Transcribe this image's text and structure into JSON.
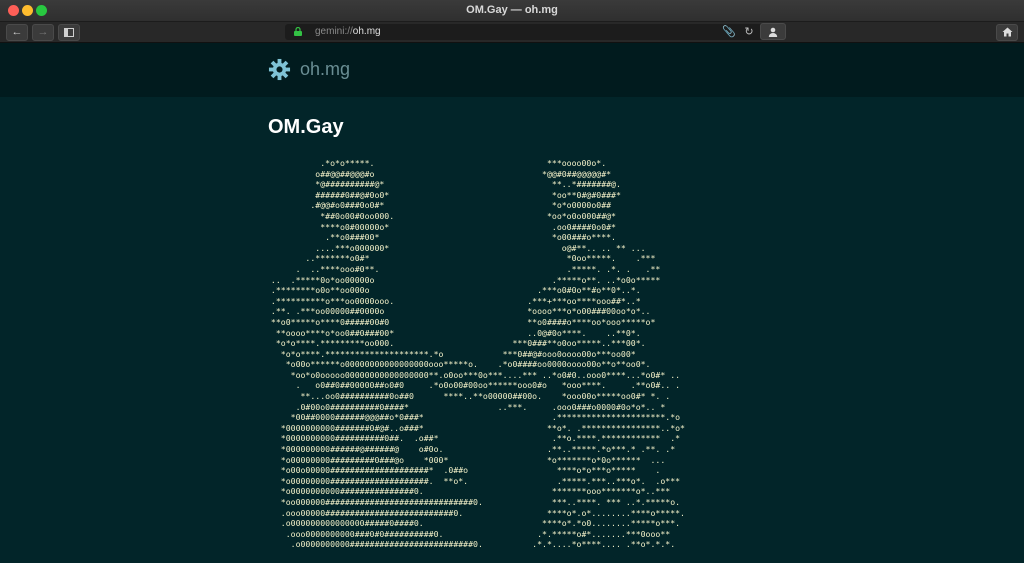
{
  "window": {
    "title": "OM.Gay — oh.mg"
  },
  "toolbar": {
    "back_icon": "arrow-left-icon",
    "forward_icon": "arrow-right-icon",
    "sidebar_icon": "sidebar-icon",
    "url_scheme": "gemini://",
    "url_host": "oh.mg",
    "home_icon": "home-icon"
  },
  "site": {
    "name": "oh.mg",
    "icon": "gear-icon"
  },
  "page": {
    "title": "OM.Gay",
    "ascii_art": "           .*o*o*****.                                   ***oooo00o*.\n          o##@@##@@@#o                                  *@@#0##@@@@@#*\n          *@##########@*                                  **..*#######@.\n          ######0##@#0o0*                                 *oo**0#@#0###*\n         .#@@#o0###0o0#*                                  *o*o0000o0##\n           *##0o00#0oo000.                               *oo*o0o000##@*\n           ****o0#00000o*                                 .oo0####0o0#*\n            .**o0###00*                                   *o00###o****.\n          ....***o000000*                                   o@#**.. .. ** ...\n        ..*******o0#*                                        *0oo*****.    .***\n      .  ..****ooo#0**.                                      .*****. .*. .   .**\n ..  .*****0o*oo00000o                                    .*****o**. ..*o0o*****\n .********o0o**oo000o                                  .***o0#0o**#o**0*..*. \n .**********o***oo0000ooo.                           .***+***oo****ooo##*..*\n .**. .***oo00000##0000o                             *oooo***o*o00###00oo*o*..\n **o0*****o****0#####00#0                            **o0####o****oo*ooo*****o*\n  **oooo****o*oo0##0###00*                           ..0@#0o****.    ..**0*.\n  *o*o****.*********oo000.                        ***0###**o0oo*****..***00*.\n   *o*o****.*********************.*o            ***0##@#ooo0oooo00o***oo00*\n    *o00o******o00000000000000000ooo*****o.    .*o0####oo0000oooo00o**o**oo0*.\n     *oo*o0ooooo00000000000000000**.o0oo***0o***....*** ..*o0#0..ooo0****...*o0#* ..\n      .   o0##0##00000##o0#0     .*o0o00#00oo******ooo0#o   *ooo****.     .**o0#.. .\n       **...oo0##########0o##0      ****..**o00000##00o.    *ooo00o*****oo0#* *. .\n      .0#00o0##########0####*                  ..***.     .ooo0###o0000#0o*o*.. *\n     *00##0000######@@@##o*0###*                          .**********************.*o\n   *0000000000#######0#@#..o###*                         **o*. .****************..*o*\n   *0000000000##########0##.  .o##*                       .**o.****.************  .*\n   *000000000######@######@    o#0o.                     .**..*****.*o***.* .**. .*\n   *o00000000#########0###@o    *000*                    *o*******o*0o******  ...\n   *o00o00000####################*  .0##o                  ****o*o***o*****    .\n   *o00000000####################.  **o*.                  .*****.***..***o*.  .o***\n   *o0000000000###############0.                          *******ooo*******o*..***\n   *oo000000##############################0.              ***..****. *** ..*.*****o.\n   .ooo00000##########################0.                 ****o*.o*........****o*****.\n   .o000000000000000#####0####0.                        ****o*.*o0........*****o***.\n    .ooo0000000000###0#0##########0.                   .*.*****o#*.......***0ooo**\n     .o0000000000#########################0.          .*.*....*o****.... .**o*.*.*."
  }
}
